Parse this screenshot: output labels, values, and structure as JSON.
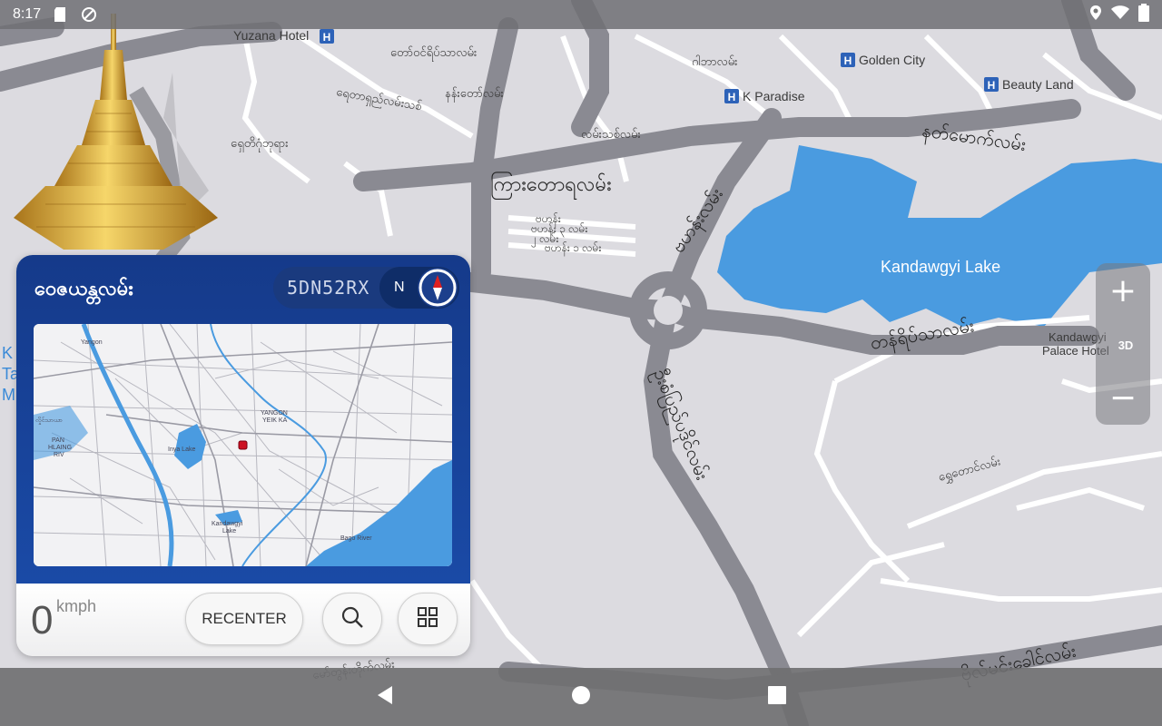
{
  "status_bar": {
    "time": "8:17"
  },
  "map": {
    "labels": {
      "yuzana_hotel": "Yuzana Hotel",
      "golden_city": "Golden City",
      "k_paradise": "K Paradise",
      "beauty_land": "Beauty Land",
      "kandawgyi_lake": "Kandawgyi Lake",
      "kandawgyi_palace": "Kandawgyi",
      "kandawgyi_palace_2": "Palace Hotel",
      "road_top1": "တော်ဝင်ရိပ်သာလမ်း",
      "road_top2": "ဂါဘာလမ်း",
      "road_top3": "ရေတာရှည်လမ်းသစ်",
      "road_top4": "နန်းတော်လမ်း",
      "road_mid1": "လမ်းသစ်လမ်း",
      "road_mid2": "ရှေတိဂုံဘုရား",
      "road_major1": "ကြားတောရလမ်း",
      "road_major2": "နတ်မောက်လမ်း",
      "road_diag": "ဗဟန်းလမ်း",
      "road_small1": "ဗဟန်း",
      "road_small2": "ဗဟန်း ၃ လမ်း",
      "road_small3": "၂ လမ်း",
      "road_small4": "ဗဟန်း ၁ လမ်း",
      "road_vertical": "ဦးစံပြည်ပဒိုင်လမ်း",
      "road_east": "တန်ရိပ်သာလမ်း",
      "road_east2": "ရွှေတောင်လမ်း",
      "road_bottom": "ဗိုလ်မင်းခေါင်လမ်း",
      "road_bottom2": "မော်တွန်းတိုက်လမ်း",
      "left_edge_1": "K",
      "left_edge_2": "Ta",
      "left_edge_3": "M"
    }
  },
  "card": {
    "street_name": "ဝေဇယန္တလမ်း",
    "plus_code": "5DN52RX",
    "compass_letter": "N",
    "minimap_labels": {
      "inya_lake": "Inya Lake",
      "kandawgyi": "Kandawgyi",
      "kandawgyi_2": "Lake",
      "bago_river": "Bago River",
      "yangon": "Yangon",
      "left_town": "လှိုင်သာယာ",
      "pan": "PAN",
      "hlaing": "HLAING",
      "riv": "RIV",
      "north": "YANGON",
      "north2": "YEIK KA"
    },
    "speed_value": "0",
    "speed_unit": "kmph",
    "recenter_label": "RECENTER"
  },
  "zoom": {
    "plus": "+",
    "minus": "−",
    "three_d": "3D"
  },
  "colors": {
    "card_blue": "#1a4aa6",
    "lake_blue": "#4a9be0",
    "road_gray": "#8a8a92",
    "marker_red": "#cc1122"
  }
}
